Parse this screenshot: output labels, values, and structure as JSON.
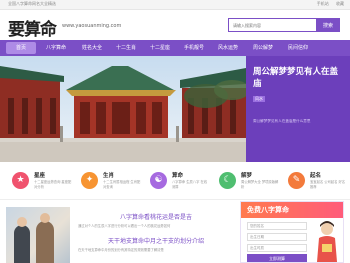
{
  "topbar": {
    "intro": "全国八字算命网名大全精选",
    "links": [
      "手机站",
      "收藏"
    ]
  },
  "header": {
    "logo": "要算命",
    "url": "www.yaosuanming.com",
    "search_placeholder": "请输入搜索内容",
    "search_button": "搜索"
  },
  "nav": {
    "items": [
      "首页",
      "八字算命",
      "姓名大全",
      "十二生肖",
      "十二星座",
      "手机靓号",
      "风水运势",
      "周公解梦",
      "民间信仰"
    ]
  },
  "banner": {
    "title": "周公解梦梦见有人在盖庙",
    "tag": "风水",
    "desc": "周公解梦梦见有人在盖庙是什么意思"
  },
  "categories": [
    {
      "title": "星座",
      "desc": "十二星座运势查询 星座配对分析",
      "icon": "star-icon",
      "color": "#f0536e"
    },
    {
      "title": "生肖",
      "desc": "十二生肖属相运程 生肖配对查询",
      "icon": "zodiac-icon",
      "color": "#f79432"
    },
    {
      "title": "算命",
      "desc": "八字算命 生辰八字 在线测算",
      "icon": "fortune-icon",
      "color": "#a66ae0"
    },
    {
      "title": "解梦",
      "desc": "周公解梦大全 梦境原版解析",
      "icon": "dream-icon",
      "color": "#4fbe70"
    },
    {
      "title": "起名",
      "desc": "宝宝起名 公司起名 好名推荐",
      "icon": "name-icon",
      "color": "#f37a3b"
    }
  ],
  "articles": [
    {
      "title": "八字算命看桃花运是否是吉",
      "desc": "通过对个人的生辰八字进行分析可以看出一个人的桃花运势如何"
    },
    {
      "title": "天干地支算命中月之干支的划分介绍",
      "desc": "在天干地支算命中月份的划分有其特定的规则需要了解清楚"
    }
  ],
  "freecard": {
    "title": "免费八字算命",
    "fields": [
      "您的姓名",
      "出生日期",
      "出生时辰"
    ],
    "button": "立即测算"
  }
}
